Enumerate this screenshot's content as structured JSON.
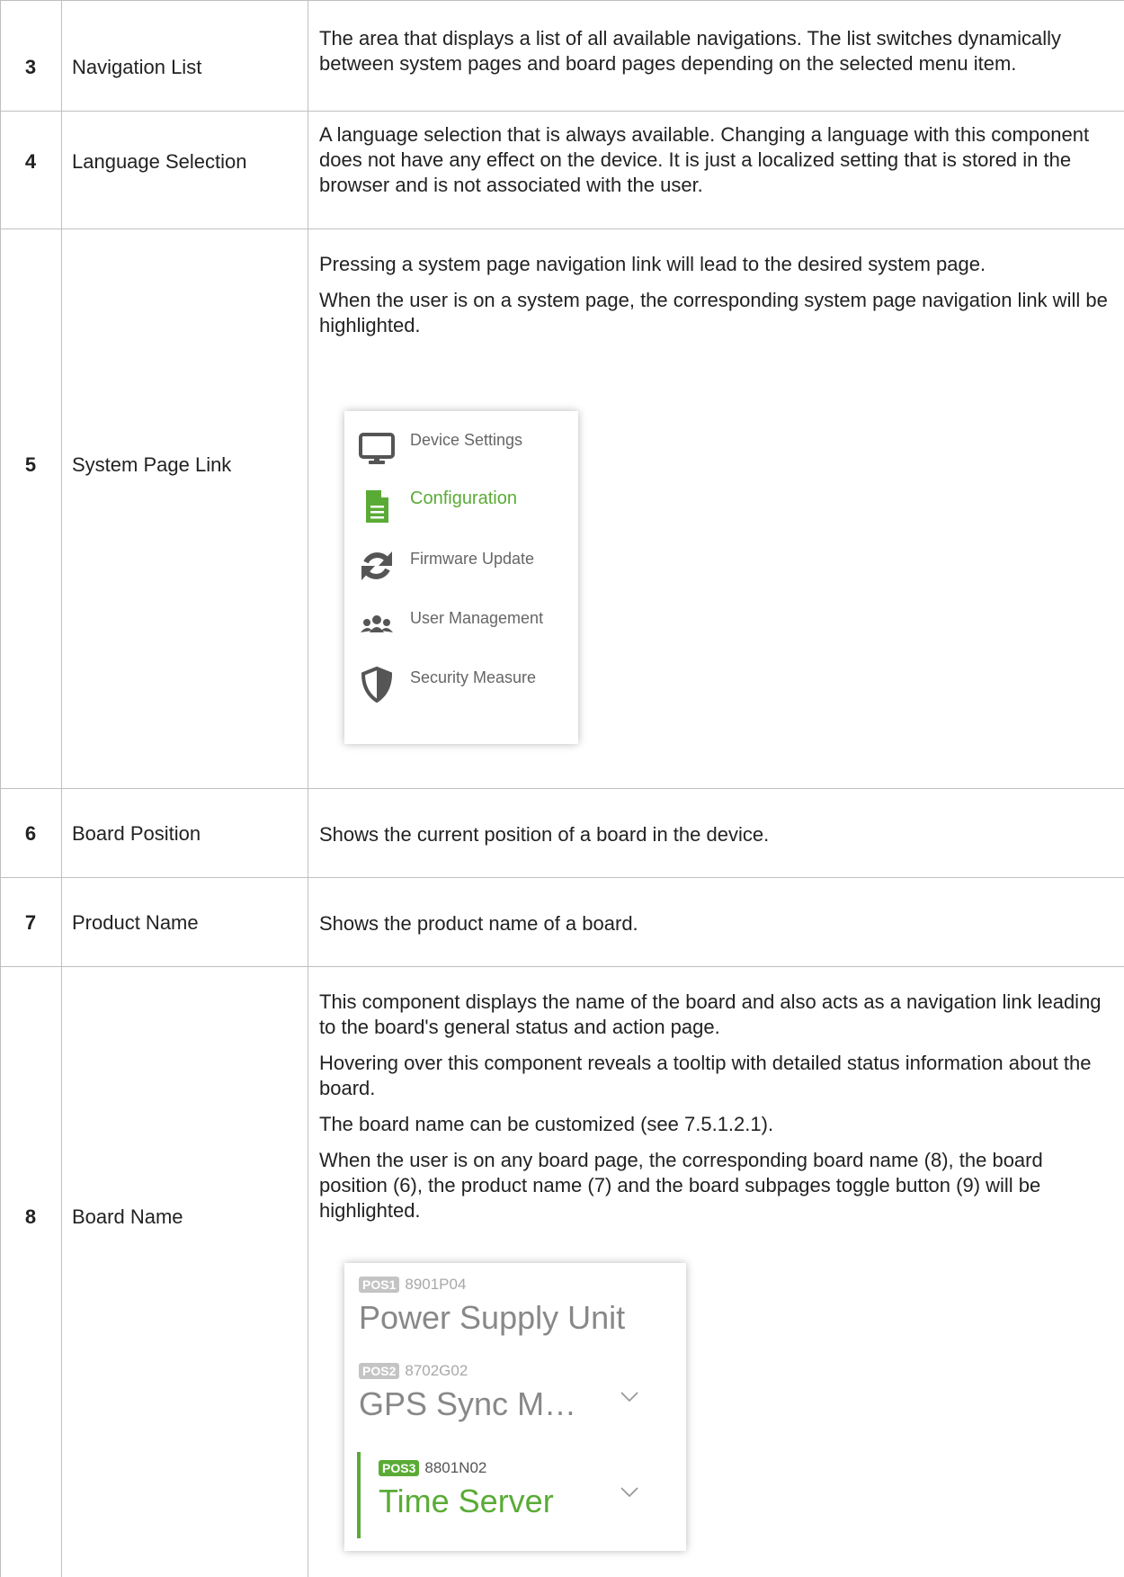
{
  "rows": [
    {
      "num": "3",
      "term": "Navigation List",
      "desc": [
        "The area that displays a list of all available navigations. The list switches dynamically between system pages and board pages depending on the selected menu item."
      ]
    },
    {
      "num": "4",
      "term": "Language Selection",
      "desc": [
        "A language selection that is always available. Changing a language with this component does not have any effect on the device. It is just a localized setting that is stored in the browser and is not associated with the user."
      ]
    },
    {
      "num": "5",
      "term": "System Page Link",
      "desc": [
        "Pressing a system page navigation link will lead to the desired system page.",
        "When the user is on a system page, the corresponding system page navigation link will be highlighted."
      ],
      "nav_items": [
        {
          "label": "Device Settings",
          "icon": "monitor-icon",
          "active": false
        },
        {
          "label": "Configuration",
          "icon": "document-icon",
          "active": true
        },
        {
          "label": "Firmware Update",
          "icon": "sync-icon",
          "active": false
        },
        {
          "label": "User Management",
          "icon": "users-icon",
          "active": false
        },
        {
          "label": "Security Measure",
          "icon": "shield-icon",
          "active": false
        }
      ]
    },
    {
      "num": "6",
      "term": "Board Position",
      "desc": [
        "Shows the current position of a board in the device."
      ]
    },
    {
      "num": "7",
      "term": "Product Name",
      "desc": [
        "Shows the product name of a board."
      ]
    },
    {
      "num": "8",
      "term": "Board Name",
      "desc": [
        "This component displays the name of the board and also acts as a navigation link leading to the board's general status and action page.",
        "Hovering over this component reveals a tooltip with detailed status information about the board.",
        "The board name can be customized (see 7.5.1.2.1).",
        "When the user is on any board page, the corresponding board name (8), the board position (6), the product name (7) and the board subpages toggle button (9) will be highlighted."
      ],
      "boards": [
        {
          "position": "POS1",
          "product": "8901P04",
          "name": "Power Supply Unit",
          "active": false,
          "has_toggle": false
        },
        {
          "position": "POS2",
          "product": "8702G02",
          "name": "GPS Sync M…",
          "active": false,
          "has_toggle": true
        },
        {
          "position": "POS3",
          "product": "8801N02",
          "name": "Time Server",
          "active": true,
          "has_toggle": true
        }
      ]
    }
  ],
  "colors": {
    "accent": "#5aab36",
    "border": "#bfbfbf",
    "muted": "#888888"
  }
}
